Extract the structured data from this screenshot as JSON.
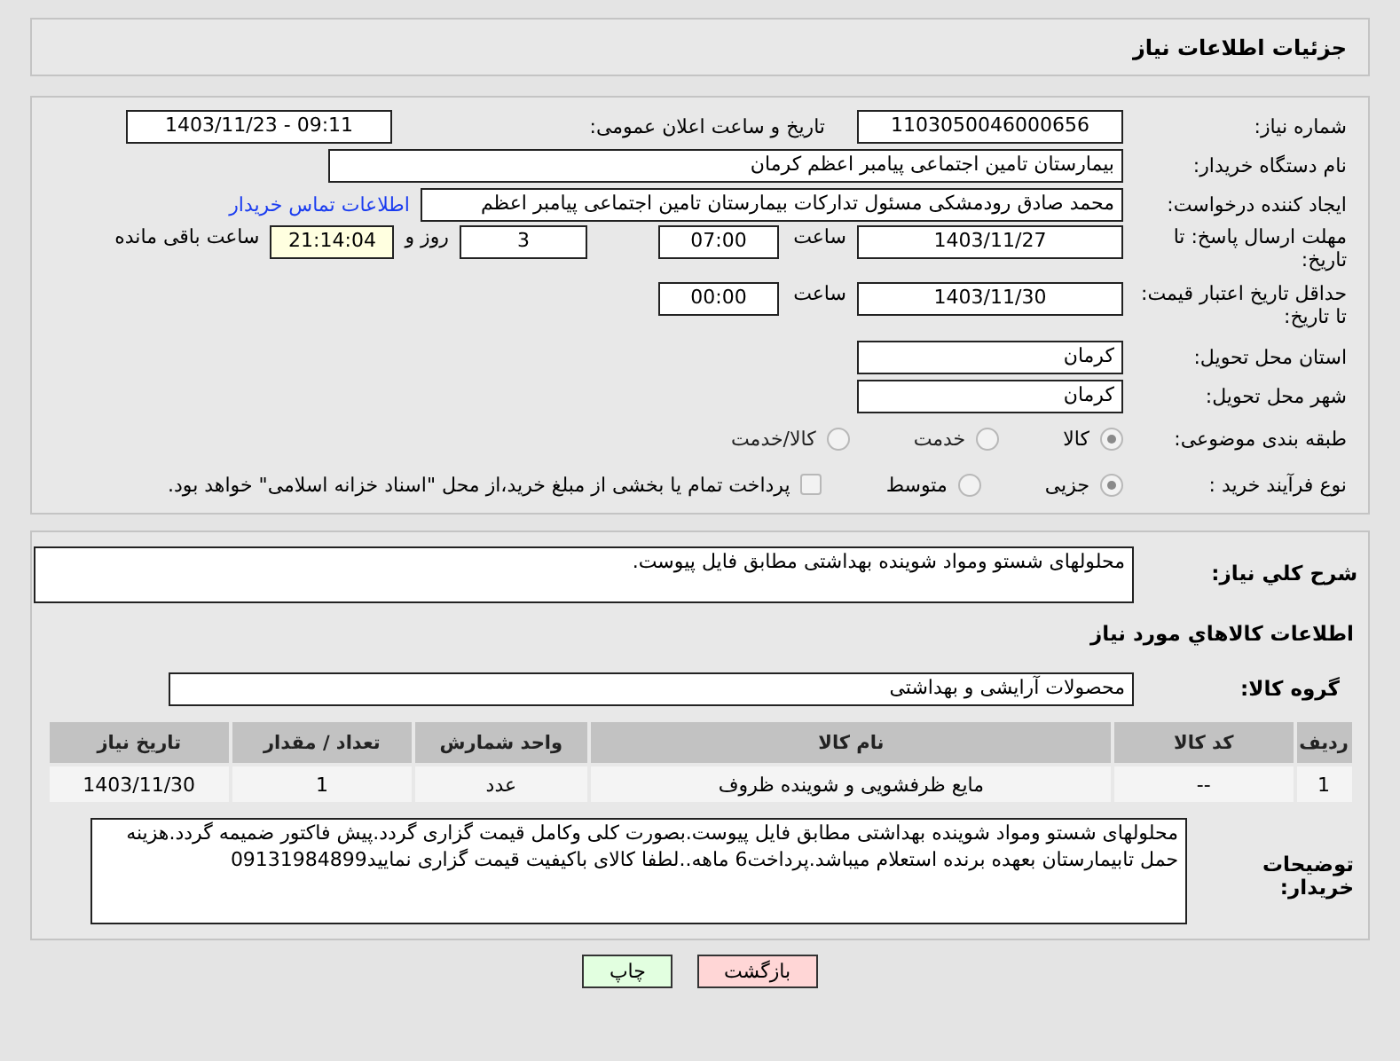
{
  "header": {
    "title": "جزئیات اطلاعات نیاز"
  },
  "need_number": {
    "label": "شماره نیاز:",
    "value": "1103050046000656"
  },
  "announce": {
    "label": "تاریخ و ساعت اعلان عمومی:",
    "value": "1403/11/23 - 09:11"
  },
  "buyer_org": {
    "label": "نام دستگاه خریدار:",
    "value": "بیمارستان تامین اجتماعی پیامبر اعظم کرمان"
  },
  "requester": {
    "label": "ایجاد کننده درخواست:",
    "value": "محمد صادق  رودمشکی مسئول تدارکات بیمارستان تامین اجتماعی پیامبر اعظم",
    "link": "اطلاعات تماس خریدار"
  },
  "reply_deadline": {
    "label": "مهلت ارسال پاسخ: تا تاریخ:",
    "date": "1403/11/27",
    "time_label": "ساعت",
    "time": "07:00",
    "days": "3",
    "days_label": "روز و",
    "remaining": "21:14:04",
    "remaining_label": "ساعت باقی مانده"
  },
  "price_validity": {
    "label": "حداقل تاریخ اعتبار قیمت: تا تاریخ:",
    "date": "1403/11/30",
    "time_label": "ساعت",
    "time": "00:00"
  },
  "province": {
    "label": "استان محل تحویل:",
    "value": "کرمان"
  },
  "city": {
    "label": "شهر محل تحویل:",
    "value": "کرمان"
  },
  "category": {
    "label": "طبقه بندی موضوعی:",
    "options": [
      {
        "label": "کالا",
        "selected": true
      },
      {
        "label": "خدمت",
        "selected": false
      },
      {
        "label": "کالا/خدمت",
        "selected": false
      }
    ]
  },
  "process": {
    "label": "نوع فرآیند خرید :",
    "options": [
      {
        "label": "جزیی",
        "selected": true
      },
      {
        "label": "متوسط",
        "selected": false
      }
    ],
    "payment": {
      "label": "پرداخت تمام یا بخشی از مبلغ خرید،از محل \"اسناد خزانه اسلامی\" خواهد بود.",
      "checked": false
    }
  },
  "description": {
    "label": "شرح کلي نياز:",
    "value": "محلولهای شستو ومواد شوینده بهداشتی مطابق فایل پیوست."
  },
  "goods_title": "اطلاعات کالاهاي مورد نياز",
  "goods_group": {
    "label": "گروه کالا:",
    "value": "محصولات آرایشی و بهداشتی"
  },
  "table": {
    "columns": [
      "ردیف",
      "کد کالا",
      "نام کالا",
      "واحد شمارش",
      "تعداد / مقدار",
      "تاریخ نیاز"
    ],
    "rows": [
      [
        "1",
        "--",
        "مایع ظرفشویی و شوینده ظروف",
        "عدد",
        "1",
        "1403/11/30"
      ]
    ]
  },
  "buyer_notes": {
    "label": "توضیحات خریدار:",
    "value": "محلولهای شستو ومواد شوینده بهداشتی مطابق فایل پیوست.بصورت کلی وکامل قیمت گزاری گردد.پیش فاکتور ضمیمه گردد.هزینه حمل تابیمارستان بعهده برنده استعلام میباشد.پرداخت6 ماهه..لطفا کالای باکیفیت قیمت گزاری نمایید09131984899"
  },
  "buttons": [
    {
      "label": "بازگشت",
      "kind": "back"
    },
    {
      "label": "چاپ",
      "kind": "print"
    }
  ]
}
